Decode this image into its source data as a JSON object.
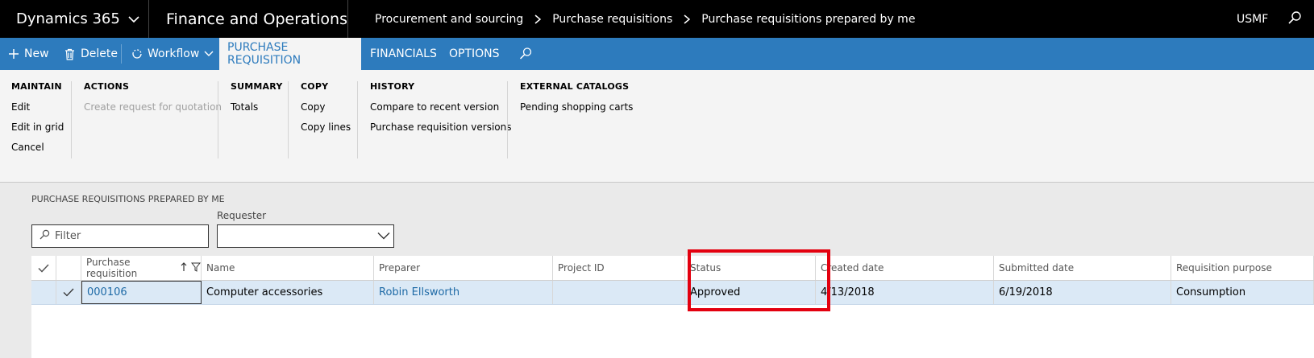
{
  "topbar": {
    "brand": "Dynamics 365",
    "app_name": "Finance and Operations",
    "breadcrumbs": [
      "Procurement and sourcing",
      "Purchase requisitions",
      "Purchase requisitions prepared by me"
    ],
    "company": "USMF"
  },
  "actionbar": {
    "new": "New",
    "delete": "Delete",
    "workflow": "Workflow",
    "tabs": [
      "PURCHASE REQUISITION",
      "FINANCIALS",
      "OPTIONS"
    ],
    "active_tab": "PURCHASE REQUISITION"
  },
  "ribbon": {
    "groups": [
      {
        "title": "MAINTAIN",
        "items": [
          "Edit",
          "Edit in grid",
          "Cancel"
        ]
      },
      {
        "title": "ACTIONS",
        "items": [
          "Create request for quotation"
        ]
      },
      {
        "title": "SUMMARY",
        "items": [
          "Totals"
        ]
      },
      {
        "title": "COPY",
        "items": [
          "Copy",
          "Copy lines"
        ]
      },
      {
        "title": "HISTORY",
        "items": [
          "Compare to recent version",
          "Purchase requisition versions"
        ]
      },
      {
        "title": "EXTERNAL CATALOGS",
        "items": [
          "Pending shopping carts"
        ]
      }
    ]
  },
  "content": {
    "section_label": "PURCHASE REQUISITIONS PREPARED BY ME",
    "filter_placeholder": "Filter",
    "requester_label": "Requester",
    "requester_value": ""
  },
  "grid": {
    "columns": [
      "Purchase requisition",
      "Name",
      "Preparer",
      "Project ID",
      "Status",
      "Created date",
      "Submitted date",
      "Requisition purpose"
    ],
    "rows": [
      {
        "purchase_requisition": "000106",
        "name": "Computer accessories",
        "preparer": "Robin Ellsworth",
        "project_id": "",
        "status": "Approved",
        "created_date": "4/13/2018",
        "submitted_date": "6/19/2018",
        "requisition_purpose": "Consumption"
      }
    ]
  },
  "colors": {
    "top_bar": "#000000",
    "action_bar": "#2d7bbd",
    "link": "#1e6aa6",
    "selected_row": "#dbe9f6",
    "highlight": "#e3000f"
  }
}
